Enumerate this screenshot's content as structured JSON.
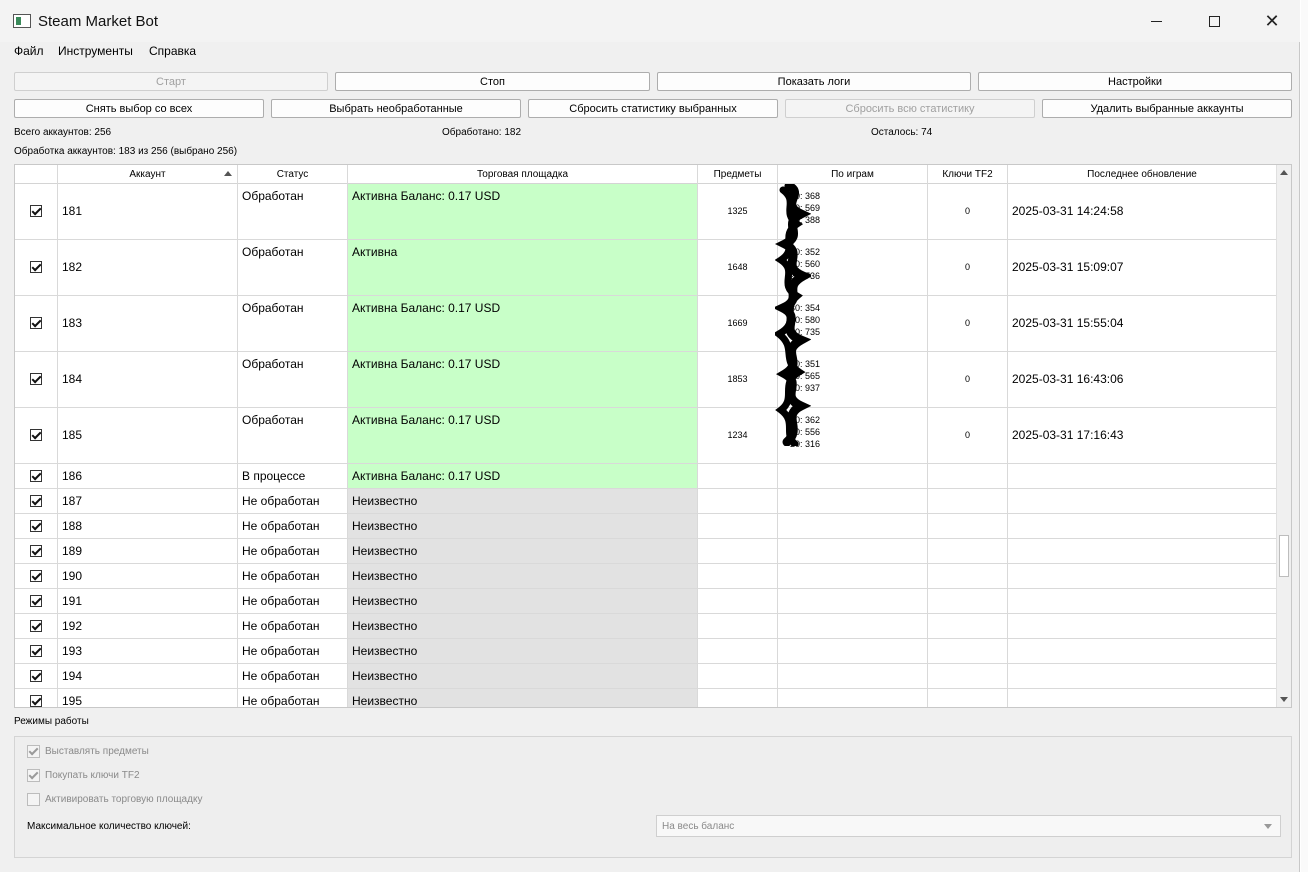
{
  "window": {
    "title": "Steam Market Bot"
  },
  "menu": [
    "Файл",
    "Инструменты",
    "Справка"
  ],
  "toolbar_row1": [
    {
      "label": "Старт",
      "disabled": true
    },
    {
      "label": "Стоп",
      "disabled": false
    },
    {
      "label": "Показать логи",
      "disabled": false
    },
    {
      "label": "Настройки",
      "disabled": false
    }
  ],
  "toolbar_row2": [
    {
      "label": "Снять выбор со всех",
      "disabled": false
    },
    {
      "label": "Выбрать необработанные",
      "disabled": false
    },
    {
      "label": "Сбросить статистику выбранных",
      "disabled": false
    },
    {
      "label": "Сбросить всю статистику",
      "disabled": true
    },
    {
      "label": "Удалить выбранные аккаунты",
      "disabled": false
    }
  ],
  "stats": {
    "total": "Всего аккаунтов: 256",
    "processed": "Обработано: 182",
    "remaining": "Осталось: 74",
    "progress": "Обработка аккаунтов: 183 из 256 (выбрано 256)"
  },
  "table": {
    "columns": [
      "",
      "Аккаунт",
      "Статус",
      "Торговая площадка",
      "Предметы",
      "По играм",
      "Ключи TF2",
      "Последнее обновление"
    ],
    "rows": [
      {
        "account": "181",
        "status": "Обработан",
        "market": "Активна Баланс: 0.17 USD",
        "market_state": "active",
        "items": "1325",
        "games": [
          "730: 368",
          "570: 569",
          "440: 388"
        ],
        "games_shown": [
          "30: 368",
          "90: 569",
          "20: 388"
        ],
        "keys": "0",
        "updated": "2025-03-31 14:24:58"
      },
      {
        "account": "182",
        "status": "Обработан",
        "market": "Активна",
        "market_state": "active",
        "items": "1648",
        "games_shown": [
          "30: 352",
          "90: 560",
          "20: 736"
        ],
        "keys": "0",
        "updated": "2025-03-31 15:09:07"
      },
      {
        "account": "183",
        "status": "Обработан",
        "market": "Активна Баланс: 0.17 USD",
        "market_state": "active",
        "items": "1669",
        "games_shown": [
          "30: 354",
          "90: 580",
          "20: 735"
        ],
        "keys": "0",
        "updated": "2025-03-31 15:55:04"
      },
      {
        "account": "184",
        "status": "Обработан",
        "market": "Активна Баланс: 0.17 USD",
        "market_state": "active",
        "items": "1853",
        "games_shown": [
          "30: 351",
          "90: 565",
          "20: 937"
        ],
        "keys": "0",
        "updated": "2025-03-31 16:43:06"
      },
      {
        "account": "185",
        "status": "Обработан",
        "market": "Активна Баланс: 0.17 USD",
        "market_state": "active",
        "items": "1234",
        "games_shown": [
          "30: 362",
          "90: 556",
          "20: 316"
        ],
        "keys": "0",
        "updated": "2025-03-31 17:16:43"
      },
      {
        "account": "186",
        "status": "В процессе",
        "market": "Активна Баланс: 0.17 USD",
        "market_state": "active",
        "items": "",
        "games_shown": [],
        "keys": "",
        "updated": ""
      },
      {
        "account": "187",
        "status": "Не обработан",
        "market": "Неизвестно",
        "market_state": "unknown",
        "items": "",
        "games_shown": [],
        "keys": "",
        "updated": ""
      },
      {
        "account": "188",
        "status": "Не обработан",
        "market": "Неизвестно",
        "market_state": "unknown",
        "items": "",
        "games_shown": [],
        "keys": "",
        "updated": ""
      },
      {
        "account": "189",
        "status": "Не обработан",
        "market": "Неизвестно",
        "market_state": "unknown",
        "items": "",
        "games_shown": [],
        "keys": "",
        "updated": ""
      },
      {
        "account": "190",
        "status": "Не обработан",
        "market": "Неизвестно",
        "market_state": "unknown",
        "items": "",
        "games_shown": [],
        "keys": "",
        "updated": ""
      },
      {
        "account": "191",
        "status": "Не обработан",
        "market": "Неизвестно",
        "market_state": "unknown",
        "items": "",
        "games_shown": [],
        "keys": "",
        "updated": ""
      },
      {
        "account": "192",
        "status": "Не обработан",
        "market": "Неизвестно",
        "market_state": "unknown",
        "items": "",
        "games_shown": [],
        "keys": "",
        "updated": ""
      },
      {
        "account": "193",
        "status": "Не обработан",
        "market": "Неизвестно",
        "market_state": "unknown",
        "items": "",
        "games_shown": [],
        "keys": "",
        "updated": ""
      },
      {
        "account": "194",
        "status": "Не обработан",
        "market": "Неизвестно",
        "market_state": "unknown",
        "items": "",
        "games_shown": [],
        "keys": "",
        "updated": ""
      },
      {
        "account": "195",
        "status": "Не обработан",
        "market": "Неизвестно",
        "market_state": "unknown",
        "items": "",
        "games_shown": [],
        "keys": "",
        "updated": ""
      }
    ]
  },
  "modes": {
    "title": "Режимы работы",
    "options": [
      {
        "label": "Выставлять предметы",
        "checked": true
      },
      {
        "label": "Покупать ключи TF2",
        "checked": true
      },
      {
        "label": "Активировать торговую площадку",
        "checked": false
      }
    ],
    "max_keys_label": "Максимальное количество ключей:",
    "max_keys_value": "На весь баланс"
  },
  "colors": {
    "active": "#c8ffc8",
    "unknown": "#e2e2e2"
  }
}
